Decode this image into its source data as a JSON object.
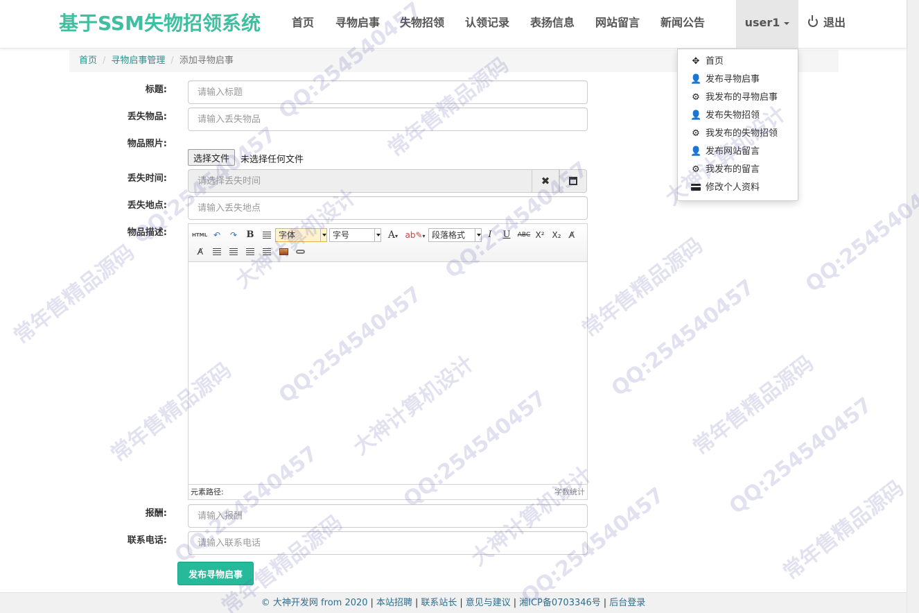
{
  "brand": "基于SSM失物招领系统",
  "nav": {
    "items": [
      "首页",
      "寻物启事",
      "失物招领",
      "认领记录",
      "表扬信息",
      "网站留言",
      "新闻公告"
    ],
    "user": "user1",
    "logout": "退出"
  },
  "dropdown": {
    "items": [
      {
        "icon": "move-icon",
        "label": "首页"
      },
      {
        "icon": "user-icon",
        "label": "发布寻物启事"
      },
      {
        "icon": "cog-icon",
        "label": "我发布的寻物启事"
      },
      {
        "icon": "user-icon",
        "label": "发布失物招领"
      },
      {
        "icon": "cog-icon",
        "label": "我发布的失物招领"
      },
      {
        "icon": "user-icon",
        "label": "发布网站留言"
      },
      {
        "icon": "cog-icon",
        "label": "我发布的留言"
      },
      {
        "icon": "credit-card-icon",
        "label": "修改个人资料"
      }
    ]
  },
  "breadcrumb": {
    "home": "首页",
    "section": "寻物启事管理",
    "current": "添加寻物启事"
  },
  "form": {
    "title_label": "标题:",
    "title_placeholder": "请输入标题",
    "item_label": "丢失物品:",
    "item_placeholder": "请输入丢失物品",
    "photo_label": "物品照片:",
    "file_button": "选择文件",
    "file_status": "未选择任何文件",
    "time_label": "丢失时间:",
    "time_placeholder": "请选择丢失时间",
    "place_label": "丢失地点:",
    "place_placeholder": "请输入丢失地点",
    "desc_label": "物品描述:",
    "reward_label": "报酬:",
    "reward_placeholder": "请输入报酬",
    "phone_label": "联系电话:",
    "phone_placeholder": "请输入联系电话",
    "submit": "发布寻物启事"
  },
  "editor": {
    "html_btn": "HTML",
    "bold": "B",
    "italic": "I",
    "underline": "U",
    "strike": "ABC",
    "font_family": "字体",
    "font_size": "字号",
    "font_color": "A",
    "paragraph": "段落格式",
    "path_label": "元素路径:",
    "word_count": "字数统计"
  },
  "footer": {
    "copyright": "© 大神开发网 from 2020",
    "links": [
      "本站招聘",
      "联系站长",
      "意见与建议",
      "湘ICP备0703346号",
      "后台登录"
    ]
  },
  "watermarks": [
    "QQ:254540457",
    "常年售精品源码",
    "大神计算机设计"
  ]
}
